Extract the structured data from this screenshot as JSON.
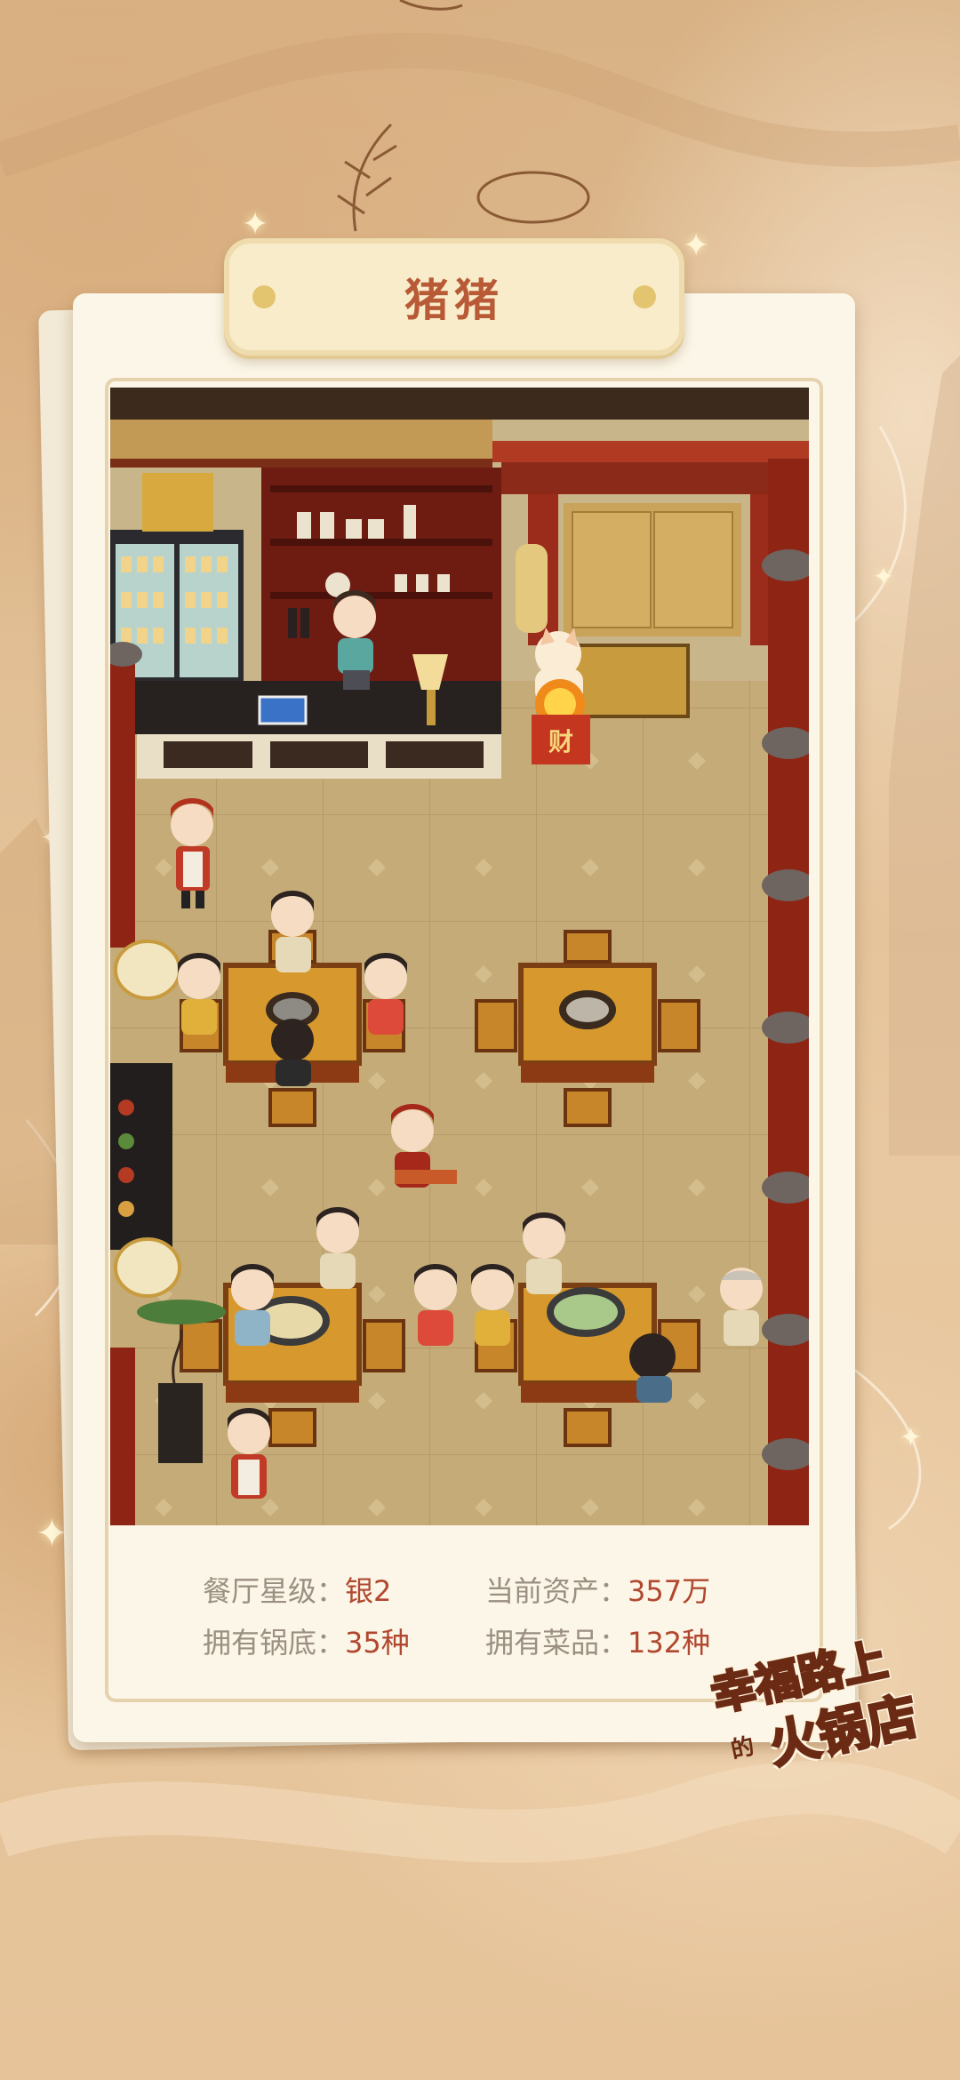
{
  "restaurant": {
    "name": "猪猪"
  },
  "stats": [
    {
      "label": "餐厅星级：",
      "value": "银2"
    },
    {
      "label": "当前资产：",
      "value": "357万"
    },
    {
      "label": "拥有锅底：",
      "value": "35种"
    },
    {
      "label": "拥有菜品：",
      "value": "132种"
    }
  ],
  "scene": {
    "fortune_char": "财"
  },
  "logo": {
    "line1": "幸福路上",
    "line2": "火锅店",
    "small": "的"
  },
  "colors": {
    "accent": "#b1472f",
    "label": "#9a8f80",
    "title": "#b85a36",
    "card": "#fbf6e7"
  },
  "icons": [
    "sparkle-icon",
    "fortune-cat-icon",
    "hotpot-icon"
  ]
}
